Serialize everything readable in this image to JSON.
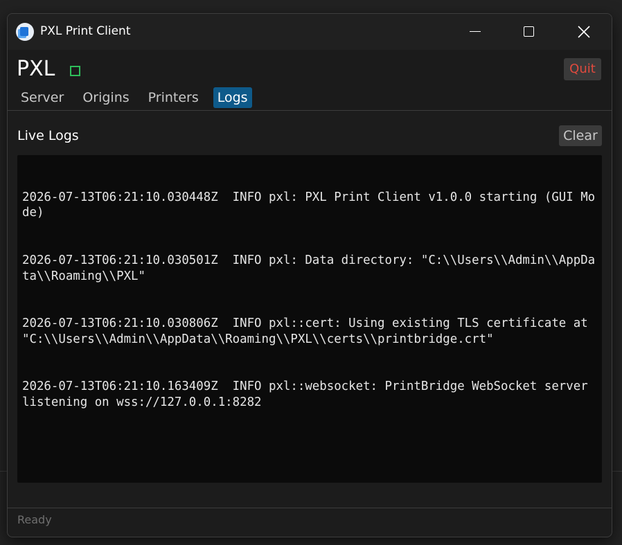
{
  "window": {
    "title": "PXL Print Client",
    "app_icon": "pxl-app-icon",
    "controls": {
      "minimize_icon": "minimize-icon",
      "maximize_icon": "maximize-icon",
      "close_icon": "close-icon"
    }
  },
  "header": {
    "brand": "PXL",
    "status_indicator_color": "#2ebd5a",
    "quit_label": "Quit",
    "quit_color": "#e04a3e"
  },
  "tabs": [
    {
      "label": "Server",
      "active": false
    },
    {
      "label": "Origins",
      "active": false
    },
    {
      "label": "Printers",
      "active": false
    },
    {
      "label": "Logs",
      "active": true
    }
  ],
  "accent_color": "#0e5a8a",
  "logs": {
    "title": "Live Logs",
    "clear_label": "Clear",
    "lines": [
      "2026-07-13T06:21:10.030448Z  INFO pxl: PXL Print Client v1.0.0 starting (GUI Mode)",
      "2026-07-13T06:21:10.030501Z  INFO pxl: Data directory: \"C:\\\\Users\\\\Admin\\\\AppData\\\\Roaming\\\\PXL\"",
      "2026-07-13T06:21:10.030806Z  INFO pxl::cert: Using existing TLS certificate at \"C:\\\\Users\\\\Admin\\\\AppData\\\\Roaming\\\\PXL\\\\certs\\\\printbridge.crt\"",
      "2026-07-13T06:21:10.163409Z  INFO pxl::websocket: PrintBridge WebSocket server listening on wss://127.0.0.1:8282"
    ]
  },
  "status_bar": {
    "text": "Ready"
  }
}
